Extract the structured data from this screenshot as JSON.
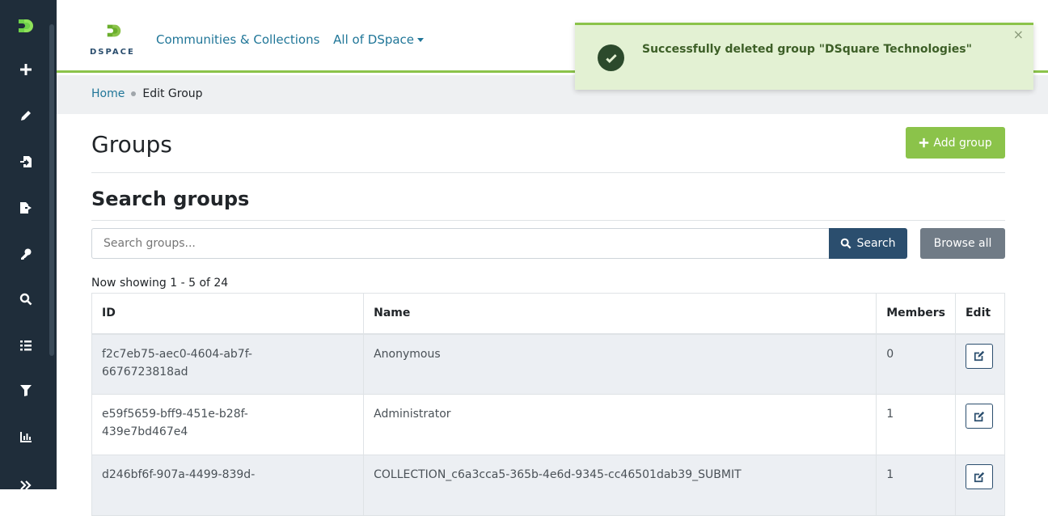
{
  "app": {
    "logo_text": "DSPACE"
  },
  "nav": {
    "items": [
      {
        "label": "Communities & Collections"
      },
      {
        "label": "All of DSpace"
      }
    ]
  },
  "sidebar": {
    "icons": [
      "plus-icon",
      "pencil-icon",
      "import-icon",
      "export-icon",
      "key-icon",
      "search-icon",
      "list-icon",
      "filter-icon",
      "chart-icon",
      "expand-icon"
    ]
  },
  "breadcrumb": {
    "home": "Home",
    "current": "Edit Group"
  },
  "page": {
    "title": "Groups",
    "add_button": "Add group",
    "search_title": "Search groups",
    "search_placeholder": "Search groups...",
    "search_button": "Search",
    "browse_button": "Browse all",
    "showing": "Now showing 1 - 5 of 24"
  },
  "table": {
    "headers": {
      "id": "ID",
      "name": "Name",
      "members": "Members",
      "edit": "Edit"
    },
    "rows": [
      {
        "id_line1": "f2c7eb75-aec0-4604-ab7f-",
        "id_line2": "6676723818ad",
        "name": "Anonymous",
        "members": "0"
      },
      {
        "id_line1": "e59f5659-bff9-451e-b28f-",
        "id_line2": "439e7bd467e4",
        "name": "Administrator",
        "members": "1"
      },
      {
        "id_line1": "d246bf6f-907a-4499-839d-",
        "id_line2": "",
        "name": "COLLECTION_c6a3cca5-365b-4e6d-9345-cc46501dab39_SUBMIT",
        "members": "1"
      }
    ]
  },
  "toast": {
    "message": "Successfully deleted group \"DSquare Technologies\"",
    "close": "×"
  },
  "colors": {
    "accent": "#8bc34a",
    "primary": "#2b4e6e",
    "link": "#207698",
    "sidebar": "#1f2d3a"
  }
}
